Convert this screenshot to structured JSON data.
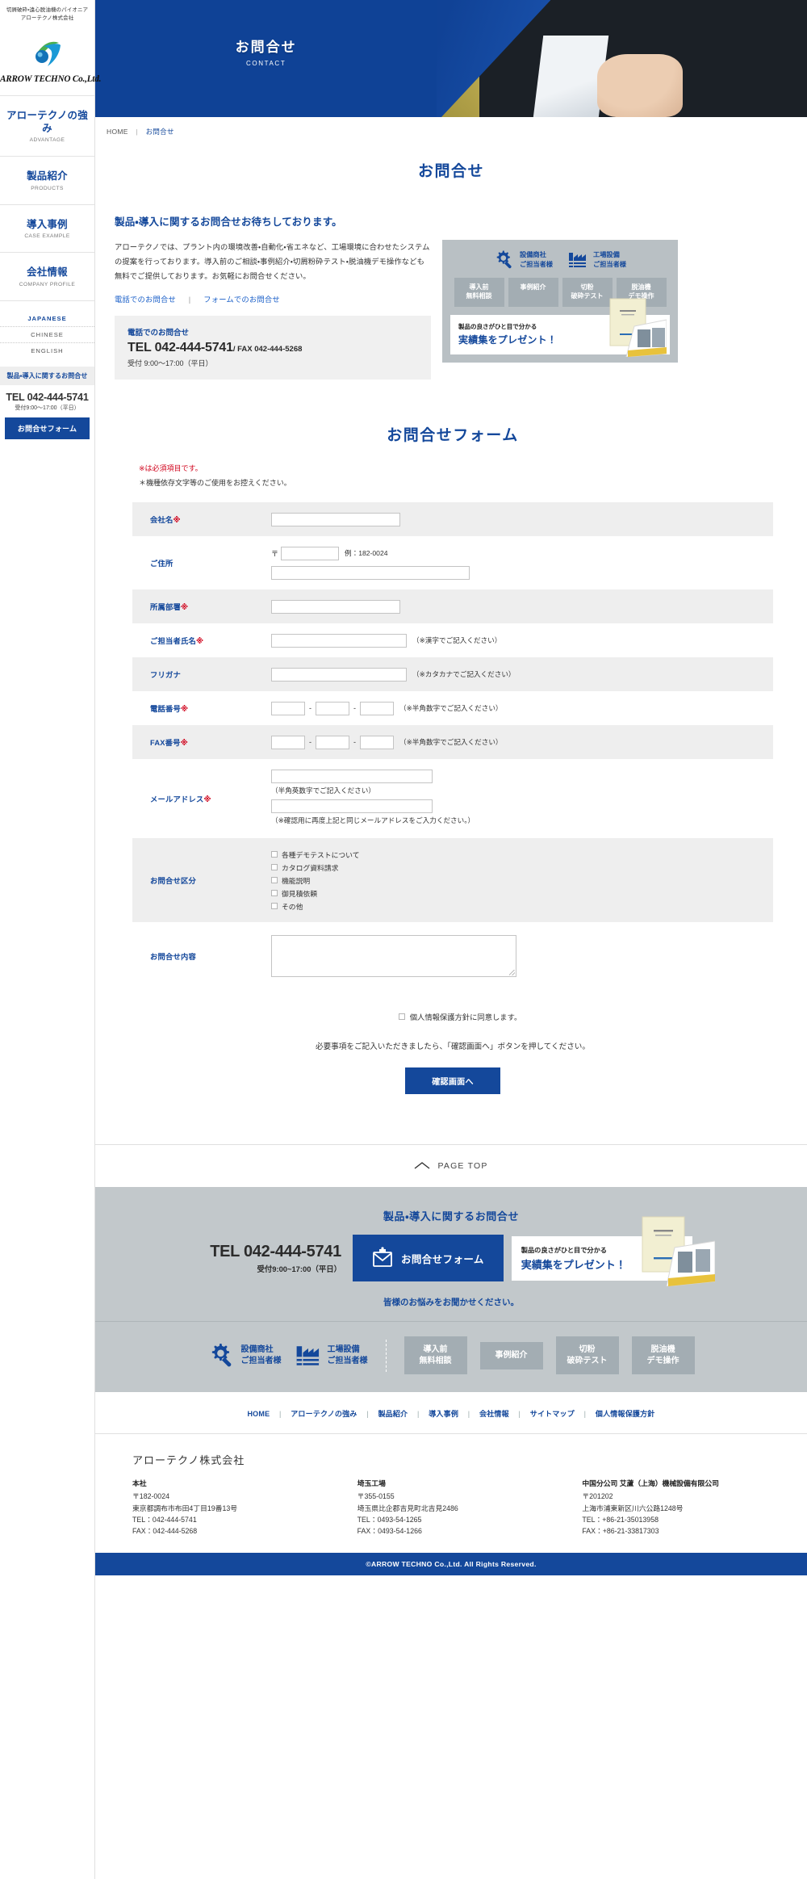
{
  "sidebar": {
    "tagline_line1": "切屑破砕・遠心脱油機のパイオニア",
    "tagline_line2": "アローテクノ株式会社",
    "logo_text": "ARROW TECHNO Co.,Ltd.",
    "nav": [
      {
        "ja": "アローテクノの強み",
        "en": "ADVANTAGE"
      },
      {
        "ja": "製品紹介",
        "en": "PRODUCTS"
      },
      {
        "ja": "導入事例",
        "en": "CASE EXAMPLE"
      },
      {
        "ja": "会社情報",
        "en": "COMPANY PROFILE"
      }
    ],
    "languages": [
      {
        "label": "JAPANESE",
        "active": true
      },
      {
        "label": "CHINESE",
        "active": false
      },
      {
        "label": "ENGLISH",
        "active": false
      }
    ],
    "cta_heading": "製品・導入に関するお問合せ",
    "cta_tel": "TEL 042-444-5741",
    "cta_hours": "受付9:00～17:00（平日）",
    "cta_button": "お問合せフォーム"
  },
  "hero": {
    "title_ja": "お問合せ",
    "title_en": "CONTACT"
  },
  "breadcrumb": {
    "home": "HOME",
    "separator": "|",
    "current": "お問合せ"
  },
  "page": {
    "title": "お問合せ",
    "lead_heading": "製品・導入に関するお問合せお待ちしております。",
    "lead_paragraph": "アローテクノでは、プラント内の環境改善・自動化・省エネなど、工場環境に合わせたシステムの提案を行っております。導入前のご相談・事例紹介・切屑粉砕テスト・脱油機デモ操作なども無料でご提供しております。お気軽にお問合せください。",
    "link_phone": "電話でのお問合せ",
    "link_separator": "|",
    "link_form": "フォームでのお問合せ",
    "tel_box": {
      "label": "電話でのお問合せ",
      "tel": "TEL 042-444-5741",
      "fax": "/ FAX 042-444-5268",
      "hours": "受付 9:00～17:00（平日）"
    }
  },
  "promo": {
    "targets": [
      {
        "icon": "gear-wrench-icon",
        "line1": "設備商社",
        "line2": "ご担当者様"
      },
      {
        "icon": "factory-icon",
        "line1": "工場設備",
        "line2": "ご担当者様"
      }
    ],
    "tags": [
      {
        "line1": "導入前",
        "line2": "無料相談"
      },
      {
        "line1": "事例紹介",
        "line2": ""
      },
      {
        "line1": "切粉",
        "line2": "破砕テスト"
      },
      {
        "line1": "脱油機",
        "line2": "デモ操作"
      }
    ],
    "gift_small": "製品の良さがひと目で分かる",
    "gift_big": "実績集をプレゼント！"
  },
  "form": {
    "title": "お問合せフォーム",
    "required_note": "※は必須項目です。",
    "charset_note": "＊機種依存文字等のご使用をお控えください。",
    "required_mark": "※",
    "rows": [
      {
        "label": "会社名",
        "required": true,
        "type": "single",
        "hint": ""
      },
      {
        "label": "ご住所",
        "required": false,
        "type": "address",
        "zip_mark": "〒",
        "zip_example": "例：182-0024"
      },
      {
        "label": "所属部署",
        "required": true,
        "type": "single",
        "hint": ""
      },
      {
        "label": "ご担当者氏名",
        "required": true,
        "type": "single",
        "hint": "（※漢字でご記入ください）"
      },
      {
        "label": "フリガナ",
        "required": false,
        "type": "single",
        "hint": "（※カタカナでご記入ください）"
      },
      {
        "label": "電話番号",
        "required": true,
        "type": "tel",
        "hint": "（※半角数字でご記入ください）",
        "separator": "-"
      },
      {
        "label": "FAX番号",
        "required": true,
        "type": "tel",
        "hint": "（※半角数字でご記入ください）",
        "separator": "-"
      },
      {
        "label": "メールアドレス",
        "required": true,
        "type": "email",
        "hint1": "（半角英数字でご記入ください）",
        "hint2": "（※確認用に再度上記と同じメールアドレスをご入力ください。）"
      },
      {
        "label": "お問合せ区分",
        "required": false,
        "type": "checkbox",
        "options": [
          "各種デモテストについて",
          "カタログ資料請求",
          "機能説明",
          "御見積依頼",
          "その他"
        ]
      },
      {
        "label": "お問合せ内容",
        "required": false,
        "type": "textarea"
      }
    ],
    "agree_label": "個人情報保護方針に同意します。",
    "submit_note": "必要事項をご記入いただきましたら、「確認画面へ」ボタンを押してください。",
    "submit_button": "確認画面へ"
  },
  "pagetop": {
    "label": "PAGE TOP",
    "icon": "chevron-up-icon"
  },
  "footer_cta": {
    "title": "製品・導入に関するお問合せ",
    "tel": "TEL 042-444-5741",
    "hours": "受付9:00~17:00（平日）",
    "button_label": "お問合せフォーム",
    "button_icon": "mail-icon",
    "gift_small": "製品の良さがひと目で分かる",
    "gift_big": "実績集をプレゼント！",
    "sub": "皆様のお悩みをお聞かせください。",
    "icons": [
      {
        "icon": "gear-wrench-icon",
        "line1": "設備商社",
        "line2": "ご担当者様"
      },
      {
        "icon": "factory-icon",
        "line1": "工場設備",
        "line2": "ご担当者様"
      }
    ],
    "tags": [
      {
        "line1": "導入前",
        "line2": "無料相談"
      },
      {
        "line1": "事例紹介",
        "line2": ""
      },
      {
        "line1": "切粉",
        "line2": "破砕テスト"
      },
      {
        "line1": "脱油機",
        "line2": "デモ操作"
      }
    ]
  },
  "footer": {
    "nav": [
      "HOME",
      "アローテクノの強み",
      "製品紹介",
      "導入事例",
      "会社情報",
      "サイトマップ",
      "個人情報保護方針"
    ],
    "nav_separator": "|",
    "company": "アローテクノ株式会社",
    "addresses": [
      {
        "name": "本社",
        "zip": "〒182-0024",
        "street": "東京都調布市布田4丁目19番13号",
        "tel": "TEL：042-444-5741",
        "fax": "FAX：042-444-5268"
      },
      {
        "name": "埼玉工場",
        "zip": "〒355-0155",
        "street": "埼玉県比企郡吉見町北吉見2486",
        "tel": "TEL：0493-54-1265",
        "fax": "FAX：0493-54-1266"
      },
      {
        "name": "中国分公司 艾蘆（上海）機械設備有限公司",
        "zip": "〒201202",
        "street": "上海市浦東新区川六公路1248号",
        "tel": "TEL：+86-21-35013958",
        "fax": "FAX：+86-21-33817303"
      }
    ],
    "copyright": "©ARROW TECHNO Co.,Ltd. All Rights Reserved."
  },
  "colors": {
    "brand_blue": "#14489b",
    "required_red": "#d0021b",
    "panel_gray": "#eeeeee",
    "cta_gray": "#c2c8cb"
  }
}
